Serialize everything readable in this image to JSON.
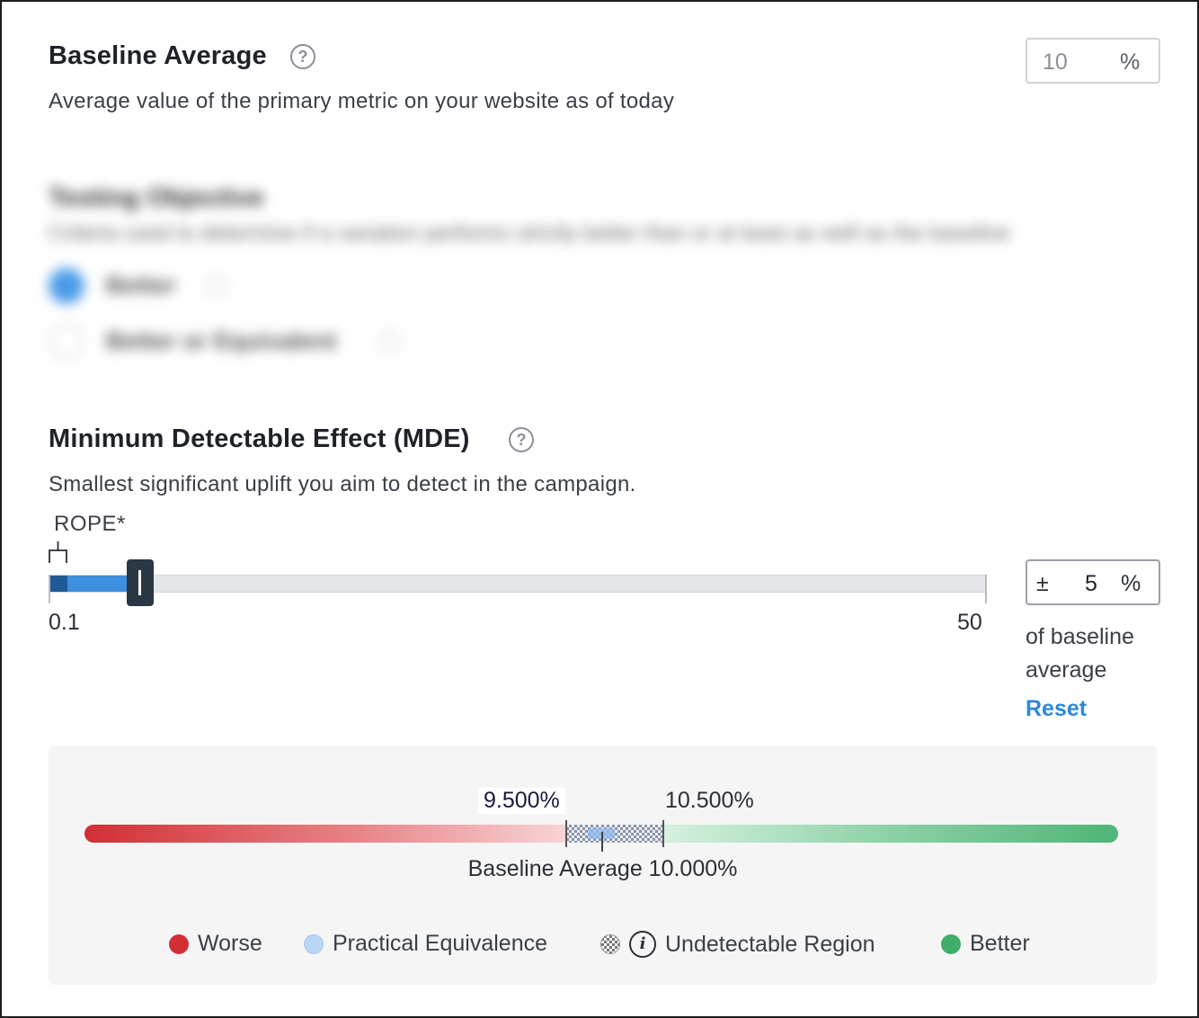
{
  "baseline": {
    "title": "Baseline Average",
    "description": "Average value of the primary metric on your website as of today",
    "input_value": "10",
    "unit": "%"
  },
  "objective": {
    "title": "Testing Objective",
    "description": "Criteria used to determine if a variation performs strictly better than or at least as well as the baseline",
    "options": [
      {
        "label": "Better",
        "selected": true
      },
      {
        "label": "Better or Equivalent",
        "selected": false
      }
    ]
  },
  "mde": {
    "title": "Minimum Detectable Effect (MDE)",
    "description": "Smallest significant uplift you aim to detect in the campaign.",
    "rope_label": "ROPE*",
    "slider_min": "0.1",
    "slider_max": "50",
    "slider_value": 5,
    "plus_minus": "±",
    "input_value": "5",
    "unit": "%",
    "caption": "of baseline average",
    "reset_label": "Reset"
  },
  "visual": {
    "lower_bound": "9.500%",
    "upper_bound": "10.500%",
    "baseline_caption": "Baseline Average 10.000%",
    "legend": {
      "worse": "Worse",
      "equivalence": "Practical Equivalence",
      "undetectable": "Undetectable Region",
      "better": "Better"
    }
  },
  "colors": {
    "accent": "#3d8fe0",
    "rope": "#1f5a96",
    "handle": "#2a3744",
    "worse": "#d12f35",
    "better": "#3fae6a",
    "link": "#2d8ad8"
  }
}
